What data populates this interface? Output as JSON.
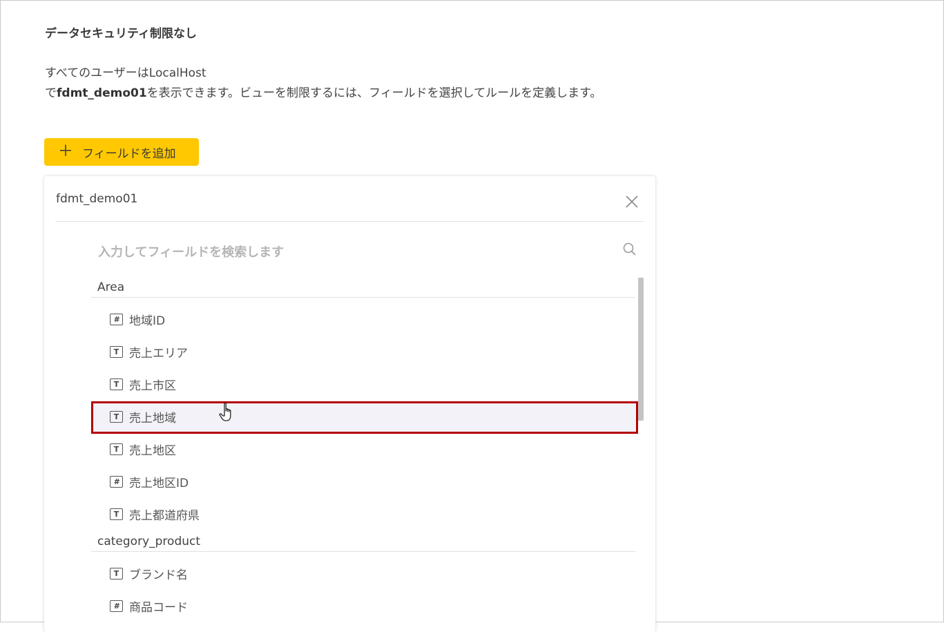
{
  "page": {
    "title": "データセキュリティ制限なし",
    "description": {
      "line1": "すべてのユーザーはLocalHost",
      "line2_prefix": "で",
      "line2_bold": "fdmt_demo01",
      "line2_suffix": "を表示できます。ビューを制限するには、フィールドを選択してルールを定義します。"
    },
    "add_field_button": {
      "icon": "plus-icon",
      "label": "フィールドを追加"
    }
  },
  "panel": {
    "title": "fdmt_demo01",
    "close_icon": "close-icon",
    "search": {
      "placeholder": "入力してフィールドを検索します",
      "value": "",
      "icon": "search-icon"
    },
    "groups": [
      {
        "name": "Area",
        "fields": [
          {
            "type": "number",
            "type_glyph": "#",
            "label": "地域ID"
          },
          {
            "type": "text",
            "type_glyph": "T",
            "label": "売上エリア"
          },
          {
            "type": "text",
            "type_glyph": "T",
            "label": "売上市区"
          },
          {
            "type": "text",
            "type_glyph": "T",
            "label": "売上地域"
          },
          {
            "type": "text",
            "type_glyph": "T",
            "label": "売上地区"
          },
          {
            "type": "number",
            "type_glyph": "#",
            "label": "売上地区ID"
          },
          {
            "type": "text",
            "type_glyph": "T",
            "label": "売上都道府県"
          }
        ]
      },
      {
        "name": "category_product",
        "fields": [
          {
            "type": "text",
            "type_glyph": "T",
            "label": "ブランド名"
          },
          {
            "type": "number",
            "type_glyph": "#",
            "label": "商品コード"
          }
        ]
      }
    ],
    "hovered_field": "売上地域"
  },
  "colors": {
    "accent_button": "#ffc800",
    "highlight_border": "#b30000",
    "hover_row": "#f2f2f8"
  }
}
